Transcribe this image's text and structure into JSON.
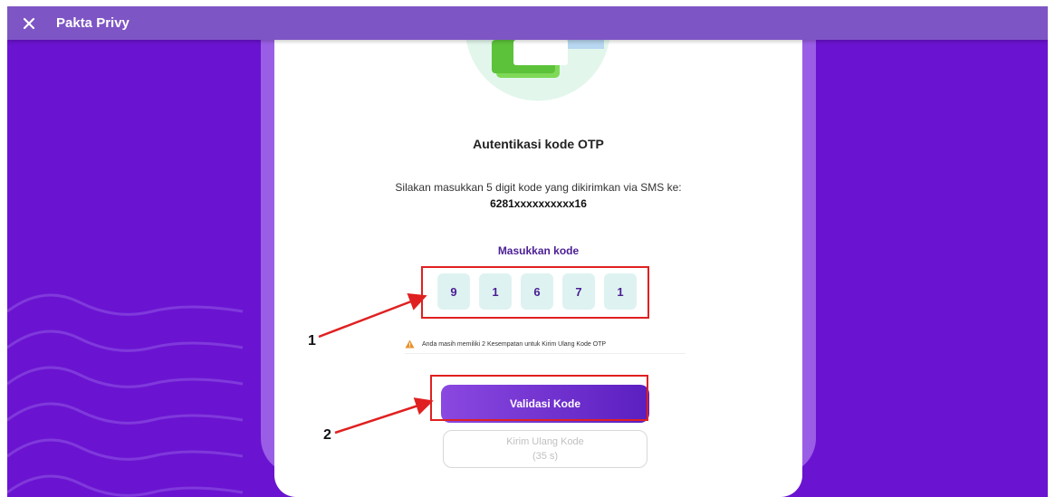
{
  "topbar": {
    "title": "Pakta Privy",
    "close_icon": "close-icon",
    "color": "#7e55c5"
  },
  "background_color": "#6a14d1",
  "card": {
    "heading": "Autentikasi kode OTP",
    "instruction": "Silakan masukkan 5 digit kode yang dikirimkan via SMS ke:",
    "phone": "6281xxxxxxxxxx16",
    "code_label": "Masukkan kode",
    "otp_digits": [
      "9",
      "1",
      "6",
      "7",
      "1"
    ],
    "warning_icon": "warning-triangle-icon",
    "warning_text": "Anda masih memiliki 2 Kesempatan untuk Kirim Ulang Kode OTP",
    "validate_label": "Validasi Kode",
    "resend_label": "Kirim Ulang Kode",
    "resend_countdown": "(35 s)"
  },
  "annotations": {
    "marker_1": "1",
    "marker_2": "2",
    "highlight_color": "#e02020"
  }
}
